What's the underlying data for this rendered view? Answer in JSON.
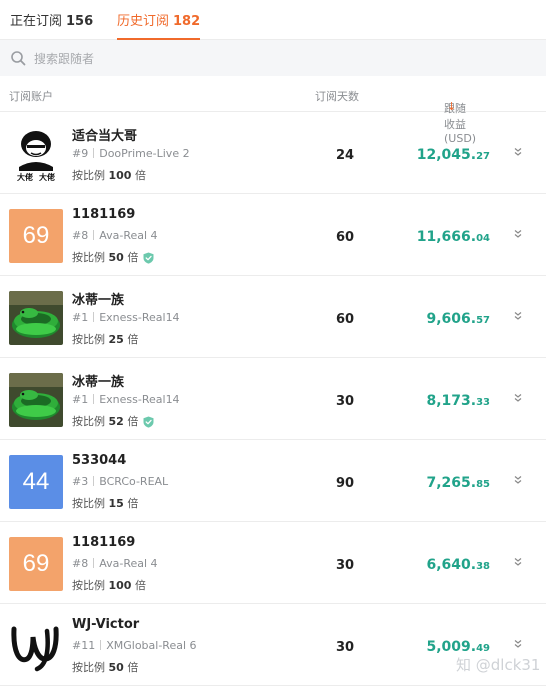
{
  "tabs": [
    {
      "label": "正在订阅",
      "count": "156",
      "active": false
    },
    {
      "label": "历史订阅",
      "count": "182",
      "active": true
    }
  ],
  "search": {
    "placeholder": "搜索跟随者"
  },
  "table": {
    "headers": {
      "account": "订阅账户",
      "days": "订阅天数",
      "profit": "跟随收益 (USD)",
      "sort_icon": "arrow-down-icon"
    }
  },
  "rows": [
    {
      "name": "适合当大哥",
      "rank": "#9",
      "server": "DooPrime-Live 2",
      "ratio_prefix": "按比例",
      "ratio_value": "100",
      "ratio_suffix": "倍",
      "verified": false,
      "days": "24",
      "profit_int": "12,045.",
      "profit_dec": "27",
      "avatar": {
        "type": "meme",
        "caption_left": "大佬",
        "caption_right": "大佬"
      }
    },
    {
      "name": "1181169",
      "rank": "#8",
      "server": "Ava-Real 4",
      "ratio_prefix": "按比例",
      "ratio_value": "50",
      "ratio_suffix": "倍",
      "verified": true,
      "days": "60",
      "profit_int": "11,666.",
      "profit_dec": "04",
      "avatar": {
        "type": "number",
        "text": "69",
        "color": "#f3a36b"
      }
    },
    {
      "name": "冰蒂一族",
      "rank": "#1",
      "server": "Exness-Real14",
      "ratio_prefix": "按比例",
      "ratio_value": "25",
      "ratio_suffix": "倍",
      "verified": false,
      "days": "60",
      "profit_int": "9,606.",
      "profit_dec": "57",
      "avatar": {
        "type": "snake"
      }
    },
    {
      "name": "冰蒂一族",
      "rank": "#1",
      "server": "Exness-Real14",
      "ratio_prefix": "按比例",
      "ratio_value": "52",
      "ratio_suffix": "倍",
      "verified": true,
      "days": "30",
      "profit_int": "8,173.",
      "profit_dec": "33",
      "avatar": {
        "type": "snake"
      }
    },
    {
      "name": "533044",
      "rank": "#3",
      "server": "BCRCo-REAL",
      "ratio_prefix": "按比例",
      "ratio_value": "15",
      "ratio_suffix": "倍",
      "verified": false,
      "days": "90",
      "profit_int": "7,265.",
      "profit_dec": "85",
      "avatar": {
        "type": "number",
        "text": "44",
        "color": "#5b8ee6"
      }
    },
    {
      "name": "1181169",
      "rank": "#8",
      "server": "Ava-Real 4",
      "ratio_prefix": "按比例",
      "ratio_value": "100",
      "ratio_suffix": "倍",
      "verified": false,
      "days": "30",
      "profit_int": "6,640.",
      "profit_dec": "38",
      "avatar": {
        "type": "number",
        "text": "69",
        "color": "#f3a36b"
      }
    },
    {
      "name": "WJ-Victor",
      "rank": "#11",
      "server": "XMGlobal-Real 6",
      "ratio_prefix": "按比例",
      "ratio_value": "50",
      "ratio_suffix": "倍",
      "verified": false,
      "days": "30",
      "profit_int": "5,009.",
      "profit_dec": "49",
      "avatar": {
        "type": "logo"
      }
    }
  ],
  "watermark": "知 @dlck31",
  "colors": {
    "accent": "#f06a2b",
    "profit": "#21a38a",
    "verified": "#6cc9ad"
  }
}
